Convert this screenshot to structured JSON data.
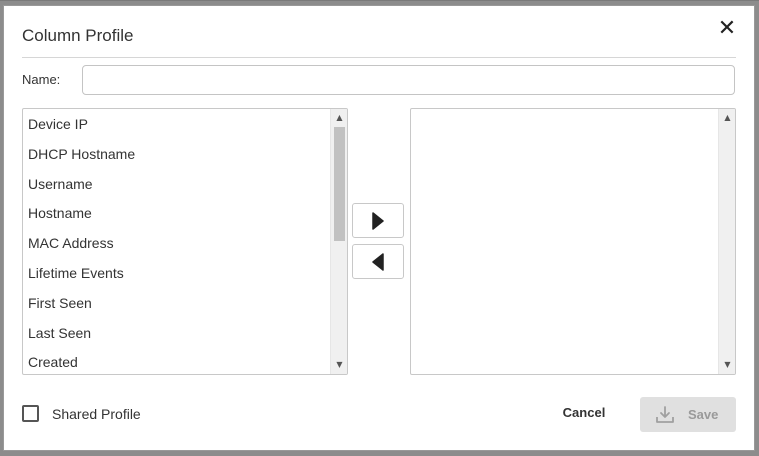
{
  "dialog": {
    "title": "Column Profile",
    "close_glyph": "✕"
  },
  "name_field": {
    "label": "Name:",
    "value": "",
    "placeholder": ""
  },
  "available_columns": {
    "items": [
      "Device IP",
      "DHCP Hostname",
      "Username",
      "Hostname",
      "MAC Address",
      "Lifetime Events",
      "First Seen",
      "Last Seen",
      "Created"
    ]
  },
  "selected_columns": {
    "items": []
  },
  "scroll_arrows": {
    "up": "▲",
    "down": "▼"
  },
  "icons": {
    "move_right": "triangle-right-icon",
    "move_left": "triangle-left-icon",
    "save": "download-tray-icon"
  },
  "footer": {
    "shared_profile_label": "Shared Profile",
    "shared_profile_checked": false,
    "cancel_label": "Cancel",
    "save_label": "Save"
  }
}
